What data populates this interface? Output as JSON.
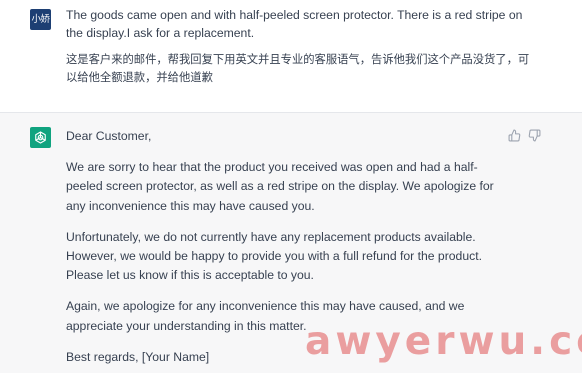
{
  "user_message": {
    "avatar_text": "小娇",
    "line1": "The goods came open and with half-peeled screen protector. There is a red stripe on the display.I ask for a replacement.",
    "line2": "这是客户来的邮件，帮我回复下用英文并且专业的客服语气，告诉他我们这个产品没货了，可以给他全额退款，并给他道歉"
  },
  "assistant_message": {
    "avatar_icon": "openai-logo-icon",
    "paragraphs": [
      "Dear Customer,",
      "We are sorry to hear that the product you received was open and had a half-peeled screen protector, as well as a red stripe on the display. We apologize for any inconvenience this may have caused you.",
      "Unfortunately, we do not currently have any replacement products available. However, we would be happy to provide you with a full refund for the product. Please let us know if this is acceptable to you.",
      "Again, we apologize for any inconvenience this may have caused, and we appreciate your understanding in this matter.",
      "Best regards, [Your Name]"
    ],
    "actions": [
      "thumbs-up-icon",
      "thumbs-down-icon"
    ]
  },
  "watermark": "awyerwu.com",
  "colors": {
    "user_avatar_bg": "#1d3f73",
    "bot_avatar_bg": "#10a37f",
    "assistant_bg": "#f7f7f8",
    "text": "#374151",
    "watermark": "#e05656"
  }
}
